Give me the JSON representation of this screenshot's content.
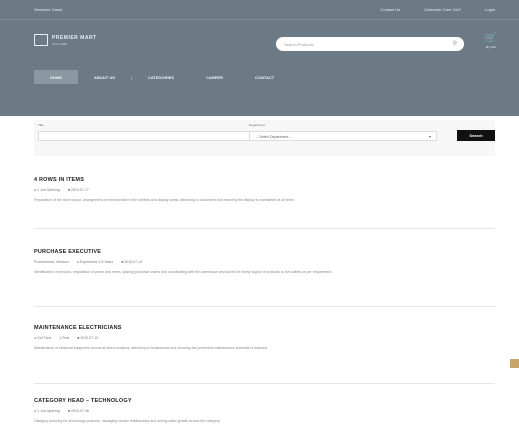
{
  "topbar": {
    "left_text": "Welcome Guest",
    "right_links": [
      "Contact Us",
      "Customer Care 24x7",
      "Login"
    ]
  },
  "brand": {
    "name": "PREMIER MART",
    "tagline": "Since 1990"
  },
  "search": {
    "placeholder": "Search Products",
    "icon": "search-icon"
  },
  "cart": {
    "icon": "cart-icon",
    "label": "My Cart"
  },
  "nav": {
    "items": [
      "HOME",
      "ABOUT US",
      "CATEGORIES",
      "CAREER",
      "CONTACT"
    ]
  },
  "filter": {
    "keyword_label": "Title",
    "keyword_value": "",
    "department_label": "Department",
    "department_value": "-- Select Department --",
    "button_label": "Search"
  },
  "jobs": [
    {
      "title": "4 ROWS IN ITEMS",
      "meta": [
        "● 1 Job Opening",
        "■ 2019-07-17"
      ],
      "desc": "Preparation of the store layout, arrangement of merchandise in the shelves and display areas, attending to customers and ensuring the display is maintained at all times."
    },
    {
      "title": "PURCHASE EXECUTIVE",
      "meta": [
        "Procurement, Vendors",
        "● Experience 3-5 Years",
        "■ 2019-07-14"
      ],
      "desc": "Identification of vendors, negotiation of prices and terms, placing purchase orders and coordinating with the warehouse and stores for timely supply of products to the outlets as per requirement."
    },
    {
      "title": "MAINTENANCE ELECTRICIANS",
      "meta": [
        "● Full Time",
        "1 Post",
        "■ 2019-07-10"
      ],
      "desc": "Maintenance of electrical equipment across all store locations, attending to breakdowns and ensuring the preventive maintenance schedule is followed."
    },
    {
      "title": "CATEGORY HEAD – TECHNOLOGY",
      "meta": [
        "● 1 Job Opening",
        "■ 2019-07-08"
      ],
      "desc": "Category planning for technology products, managing vendor relationships and driving sales growth across the category."
    }
  ],
  "colors": {
    "header": "#6b7a85",
    "button": "#111111",
    "side_tab": "#c9a46a"
  }
}
